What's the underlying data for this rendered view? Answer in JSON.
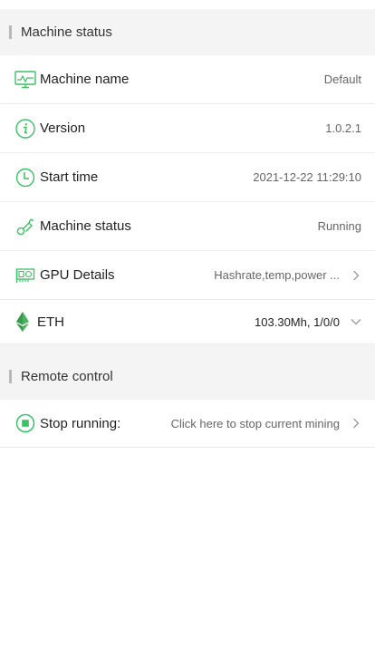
{
  "colors": {
    "accent": "#3cc065",
    "eth_green": "#3aa854",
    "section_bg": "#f4f4f4",
    "divider": "#ececec"
  },
  "machine_section": {
    "title": "Machine status",
    "rows": {
      "machine_name": {
        "label": "Machine name",
        "value": "Default",
        "icon": "monitor-icon"
      },
      "version": {
        "label": "Version",
        "value": "1.0.2.1",
        "icon": "info-icon"
      },
      "start_time": {
        "label": "Start time",
        "value": "2021-12-22 11:29:10",
        "icon": "clock-icon"
      },
      "machine_status": {
        "label": "Machine status",
        "value": "Running",
        "icon": "running-icon"
      },
      "gpu_details": {
        "label": "GPU Details",
        "value": "Hashrate,temp,power ...",
        "icon": "gpu-card-icon"
      },
      "eth": {
        "label": "ETH",
        "value": "103.30Mh, 1/0/0",
        "icon": "ethereum-icon"
      }
    }
  },
  "remote_section": {
    "title": "Remote control",
    "rows": {
      "stop_running": {
        "label": "Stop running:",
        "value": "Click here to stop current mining",
        "icon": "stop-circle-icon"
      }
    }
  }
}
